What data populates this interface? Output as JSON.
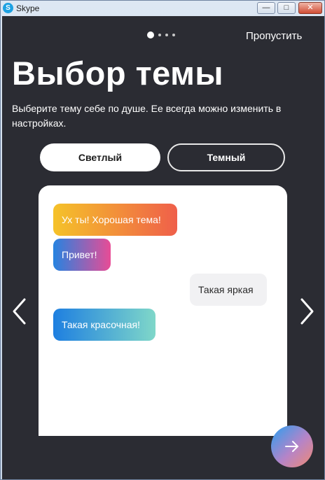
{
  "window": {
    "title": "Skype",
    "app_icon_letter": "S",
    "controls": {
      "minimize": "—",
      "maximize": "□",
      "close": "✕"
    }
  },
  "onboarding": {
    "pager": {
      "total": 4,
      "active": 1
    },
    "skip_label": "Пропустить",
    "heading": "Выбор темы",
    "subtitle": "Выберите тему себе по душе. Ее всегда можно изменить в настройках.",
    "themes": {
      "light_label": "Светлый",
      "dark_label": "Темный",
      "selected": "light"
    },
    "preview_messages": [
      {
        "text": "Ух ты! Хорошая тема!",
        "side": "left"
      },
      {
        "text": "Привет!",
        "side": "left"
      },
      {
        "text": "Такая яркая",
        "side": "right"
      },
      {
        "text": "Такая красочная!",
        "side": "left"
      }
    ],
    "icons": {
      "prev": "chevron-left-icon",
      "next_page": "chevron-right-icon",
      "continue": "arrow-right-icon"
    }
  },
  "colors": {
    "background": "#2b2c33",
    "accent_gradient": [
      "#2a9ff0",
      "#f08a72"
    ],
    "bubble_warm": [
      "#f5c229",
      "#ef5f4a"
    ],
    "bubble_pink": [
      "#2683e0",
      "#e84c96"
    ],
    "bubble_teal": [
      "#1e7fe0",
      "#7fd7c9"
    ]
  }
}
